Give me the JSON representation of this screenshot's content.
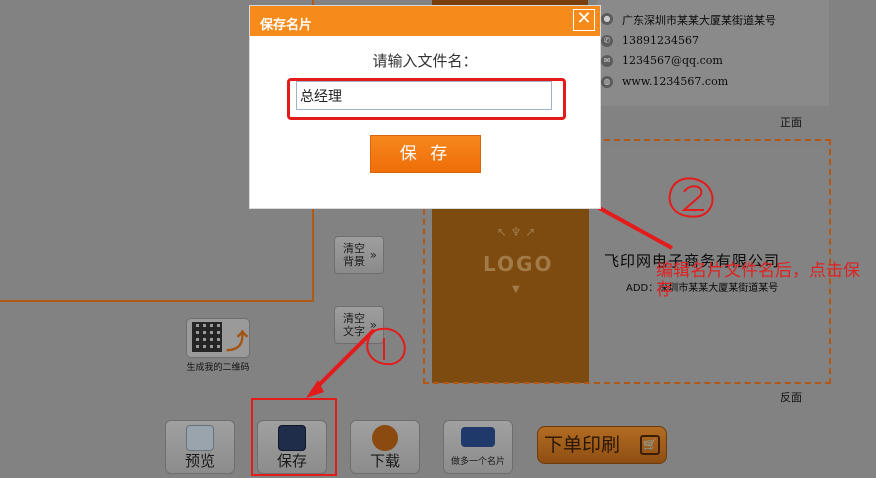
{
  "modal": {
    "title": "保存名片",
    "close_icon": "close-icon",
    "prompt": "请输入文件名：",
    "filename_value": "总经理",
    "save_label": "保 存"
  },
  "side_buttons": {
    "clear_bg": "清空背景",
    "clear_text": "清空文字"
  },
  "qr": {
    "label": "生成我的二维码"
  },
  "card_front": {
    "address": "广东深圳市某某大厦某街道某号",
    "phone": "13891234567",
    "email": "1234567@qq.com",
    "website": "www.1234567.com",
    "side_label": "正面"
  },
  "card_back": {
    "logo": "LOGO",
    "company": "飞印网电子商务有限公司",
    "address": "ADD：深圳市某某大厦某街道某号",
    "side_label": "反面"
  },
  "toolbar": {
    "preview": "预览",
    "save": "保存",
    "download": "下载",
    "more_card": "做多一个名片",
    "order": "下单印刷"
  },
  "annotations": {
    "note": "编辑名片文件名后，点击保存",
    "colors": {
      "annotation_red": "#e41b1b",
      "brand_orange": "#f68a1b"
    }
  }
}
